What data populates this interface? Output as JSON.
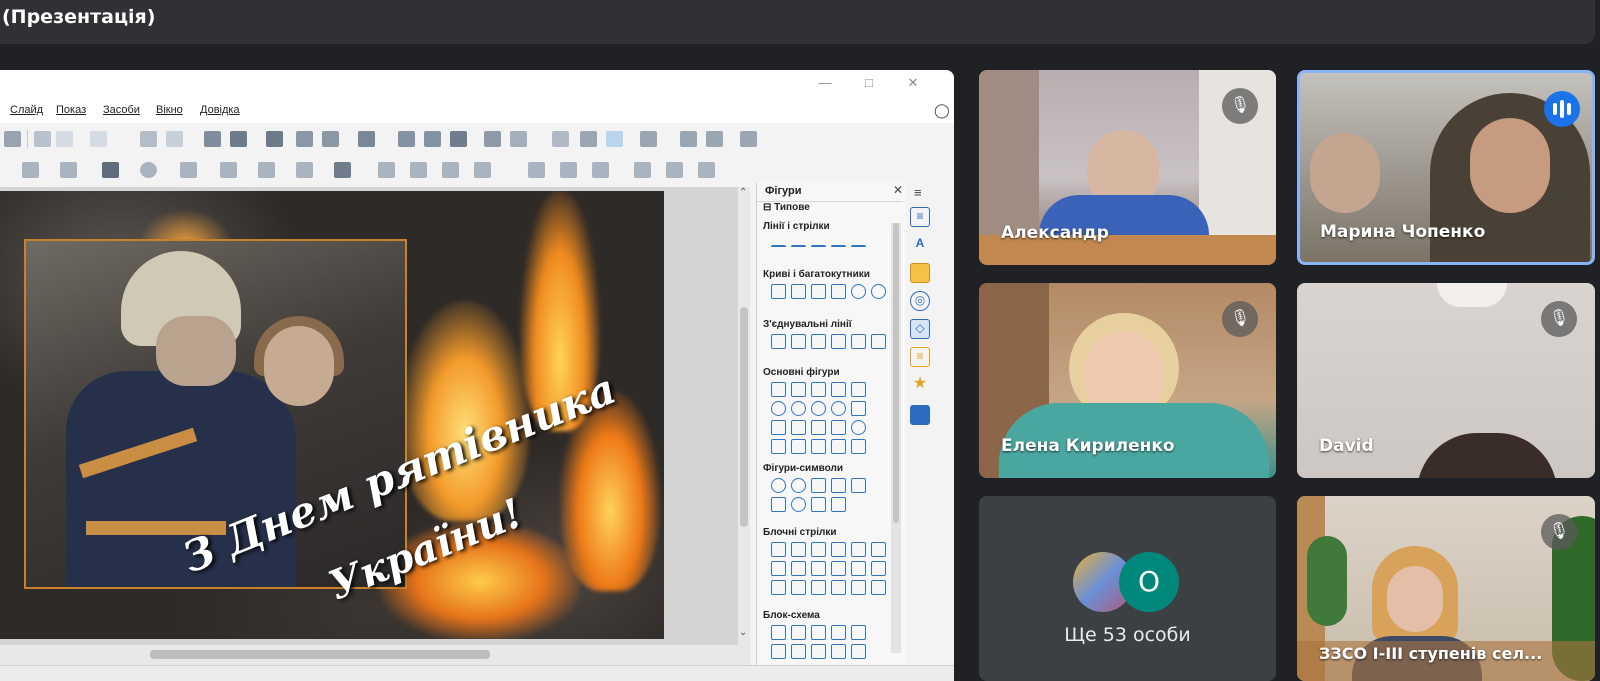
{
  "topbar": {
    "title": "(Презентація)"
  },
  "presentation": {
    "menu": [
      "Слайд",
      "Показ",
      "Засоби",
      "Вікно",
      "Довідка"
    ],
    "slide": {
      "text_line1": "З Днем рятівника",
      "text_line2": "України!"
    },
    "sidebar": {
      "title": "Фігури",
      "group": "Типове",
      "categories": [
        "Лінії і стрілки",
        "Криві і багатокутники",
        "З'єднувальні лінії",
        "Основні фігури",
        "Фігури-символи",
        "Блочні стрілки",
        "Блок-схема"
      ]
    }
  },
  "participants": [
    {
      "name": "Александр",
      "mic": "muted"
    },
    {
      "name": "Марина Чопенко",
      "mic": "speaking"
    },
    {
      "name": "Елена Кириленко",
      "mic": "muted"
    },
    {
      "name": "David",
      "mic": "muted"
    },
    {
      "name": "ЗЗСО І-ІІІ ступенів сел...",
      "mic": "muted"
    }
  ],
  "overflow": {
    "avatar_letter": "O",
    "label": "Ще 53 особи"
  },
  "colors": {
    "accent": "#1a73e8",
    "background": "#202124",
    "tile": "#3c4043",
    "avatar_o": "#00897b"
  }
}
